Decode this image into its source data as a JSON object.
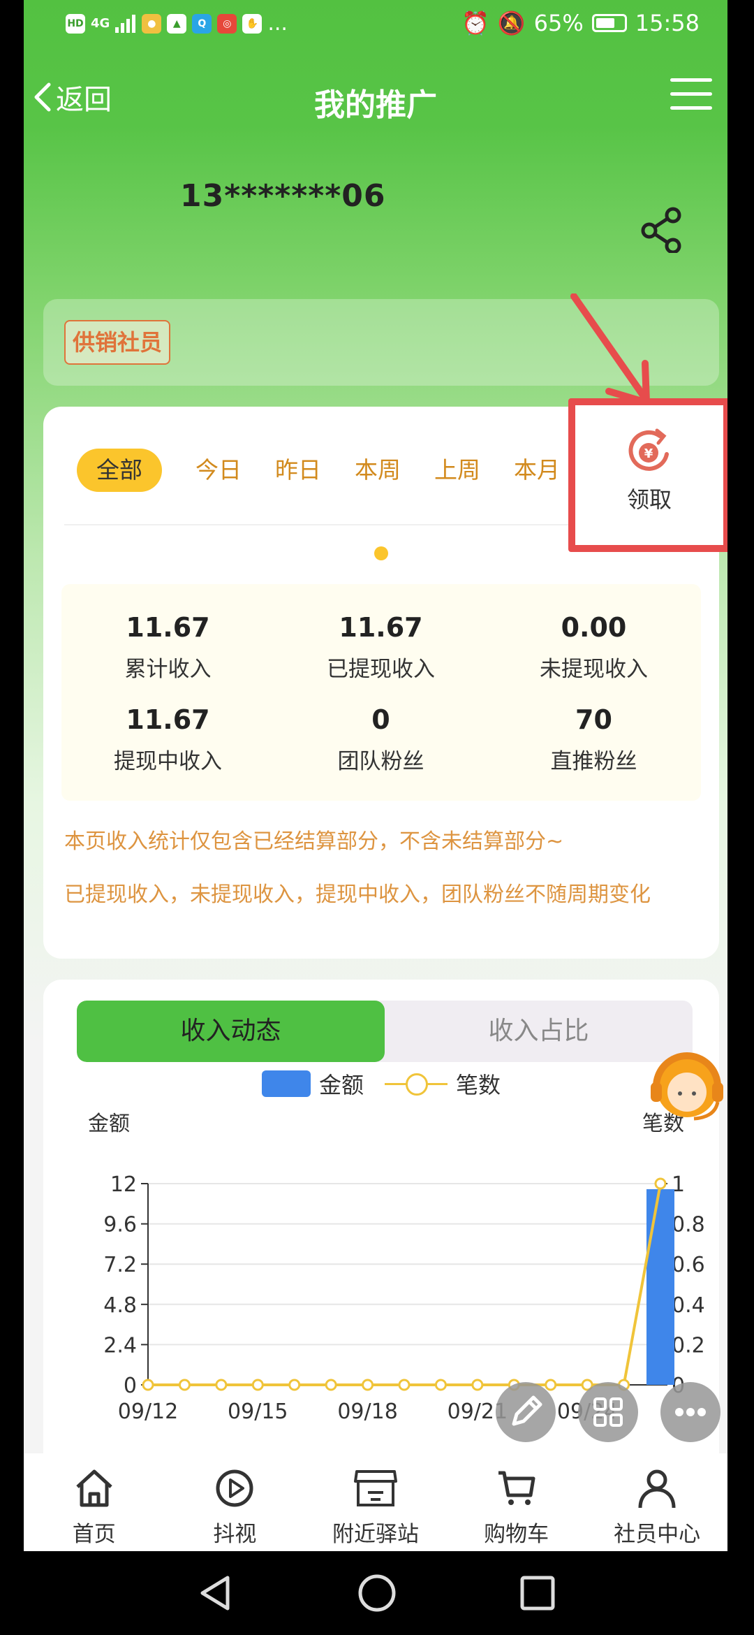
{
  "status_bar": {
    "left_icons": [
      "HD",
      "4G",
      "signal-icon",
      "app-icon",
      "qq-icon",
      "app-icon",
      "app-icon",
      "app-icon",
      "..."
    ],
    "battery": "65%",
    "time": "15:58"
  },
  "nav": {
    "back_label": "返回",
    "title": "我的推广"
  },
  "profile": {
    "phone": "13*******06",
    "badge": "供销社员"
  },
  "period_tabs": [
    "全部",
    "今日",
    "昨日",
    "本周",
    "上周",
    "本月"
  ],
  "claim": {
    "label": "领取"
  },
  "stats": [
    {
      "value": "11.67",
      "label": "累计收入"
    },
    {
      "value": "11.67",
      "label": "已提现收入"
    },
    {
      "value": "0.00",
      "label": "未提现收入"
    },
    {
      "value": "11.67",
      "label": "提现中收入"
    },
    {
      "value": "0",
      "label": "团队粉丝"
    },
    {
      "value": "70",
      "label": "直推粉丝"
    }
  ],
  "notes": [
    "本页收入统计仅包含已经结算部分，不含未结算部分~",
    "已提现收入，未提现收入，提现中收入，团队粉丝不随周期变化"
  ],
  "chart_tabs": [
    "收入动态",
    "收入占比"
  ],
  "colors": {
    "green": "#53c141",
    "amount_bar": "#3f86ea",
    "count_line": "#f0c43a",
    "highlight_box": "#e74c4c"
  },
  "chart_data": {
    "type": "bar",
    "legend": [
      "金额",
      "笔数"
    ],
    "ylabel_left": "金额",
    "ylabel_right": "笔数",
    "yticks_left": [
      "12",
      "9.6",
      "7.2",
      "4.8",
      "2.4",
      "0"
    ],
    "yticks_right": [
      "1",
      "0.8",
      "0.6",
      "0.4",
      "0.2",
      "0"
    ],
    "ylim_left": [
      0,
      12
    ],
    "ylim_right": [
      0,
      1
    ],
    "xtick_labels": [
      "09/12",
      "09/15",
      "09/18",
      "09/21",
      "09/24"
    ],
    "x": [
      "09/12",
      "09/13",
      "09/14",
      "09/15",
      "09/16",
      "09/17",
      "09/18",
      "09/19",
      "09/20",
      "09/21",
      "09/22",
      "09/23",
      "09/24",
      "09/25",
      "09/26"
    ],
    "series": [
      {
        "name": "金额",
        "type": "bar",
        "values": [
          0,
          0,
          0,
          0,
          0,
          0,
          0,
          0,
          0,
          0,
          0,
          0,
          0,
          0,
          11.67
        ]
      },
      {
        "name": "笔数",
        "type": "line",
        "values": [
          0,
          0,
          0,
          0,
          0,
          0,
          0,
          0,
          0,
          0,
          0,
          0,
          0,
          0,
          1
        ]
      }
    ]
  },
  "bottom_nav": [
    "首页",
    "抖视",
    "附近驿站",
    "购物车",
    "社员中心"
  ]
}
